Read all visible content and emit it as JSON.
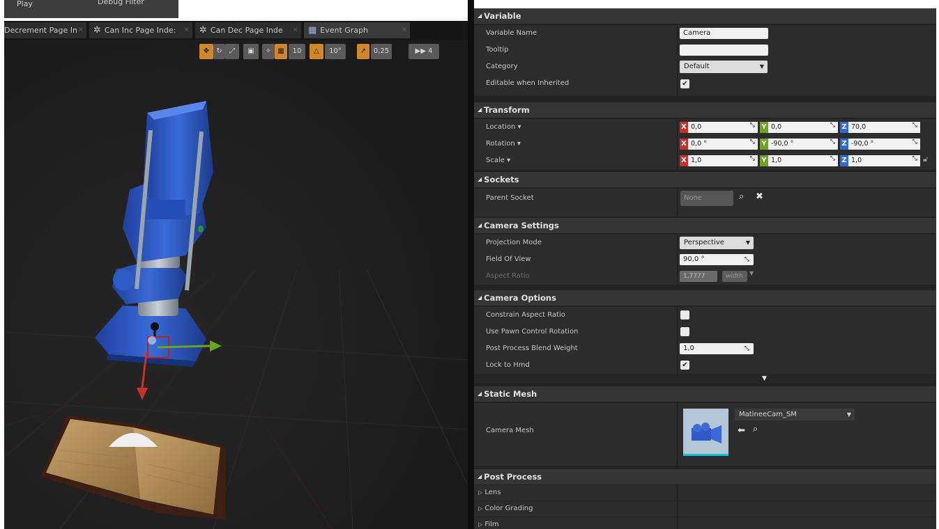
{
  "top_buttons": {
    "play": "Play",
    "debug_filter": "Debug Filter"
  },
  "tabs": [
    {
      "label": "Decrement Page In",
      "icon": "none"
    },
    {
      "label": "Can Inc Page Inde:",
      "icon": "function-gear-icon"
    },
    {
      "label": "Can Dec Page Inde",
      "icon": "function-gear-icon"
    },
    {
      "label": "Event Graph",
      "icon": "event-graph-grid-icon"
    }
  ],
  "viewport_toolbar": {
    "grid_snap_value": "10",
    "rotation_snap_value": "10°",
    "scale_snap_value": "0,25",
    "camera_speed": "4"
  },
  "details": {
    "variable": {
      "header": "Variable",
      "name_label": "Variable Name",
      "name_value": "Camera",
      "tooltip_label": "Tooltip",
      "tooltip_value": "",
      "category_label": "Category",
      "category_value": "Default",
      "editable_label": "Editable when Inherited",
      "editable_checked": true
    },
    "transform": {
      "header": "Transform",
      "location_label": "Location",
      "rotation_label": "Rotation",
      "scale_label": "Scale",
      "location": {
        "x": "0,0",
        "y": "0,0",
        "z": "70,0"
      },
      "rotation": {
        "x": "0,0 °",
        "y": "-90,0 °",
        "z": "-90,0 °"
      },
      "scale": {
        "x": "1,0",
        "y": "1,0",
        "z": "1,0"
      }
    },
    "sockets": {
      "header": "Sockets",
      "parent_socket_label": "Parent Socket",
      "parent_socket_value": "None"
    },
    "camera_settings": {
      "header": "Camera Settings",
      "projection_mode_label": "Projection Mode",
      "projection_mode_value": "Perspective",
      "fov_label": "Field Of View",
      "fov_value": "90,0 °",
      "aspect_ratio_label": "Aspect Ratio",
      "aspect_ratio_value": "1,7777",
      "aspect_ratio_preset": "width"
    },
    "camera_options": {
      "header": "Camera Options",
      "constrain_label": "Constrain Aspect Ratio",
      "constrain_checked": false,
      "pawn_rotation_label": "Use Pawn Control Rotation",
      "pawn_rotation_checked": false,
      "blend_weight_label": "Post Process Blend Weight",
      "blend_weight_value": "1,0",
      "lock_hmd_label": "Lock to Hmd",
      "lock_hmd_checked": true
    },
    "static_mesh": {
      "header": "Static Mesh",
      "camera_mesh_label": "Camera Mesh",
      "camera_mesh_value": "MatineeCam_SM"
    },
    "post_process": {
      "header": "Post Process",
      "items": [
        "Lens",
        "Color Grading",
        "Film"
      ]
    }
  },
  "colors": {
    "axis_x": "#c8302b",
    "axis_y": "#6aa51d",
    "axis_z": "#2f6ad8",
    "accent_orange": "#d2862a",
    "panel_bg": "#2c2c2c",
    "viewport_bg": "#1e1e1e"
  }
}
